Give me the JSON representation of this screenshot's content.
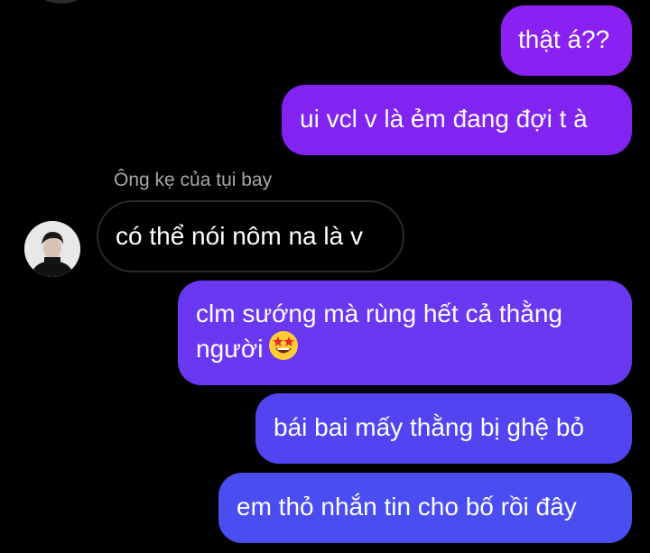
{
  "conversation": {
    "messages": [
      {
        "direction": "outgoing",
        "text": "thật á??"
      },
      {
        "direction": "outgoing",
        "text": "ui vcl v là ẻm đang đợi t à"
      },
      {
        "direction": "incoming",
        "sender": "Ông kẹ của tụi bay",
        "text": "có thể nói nôm na là v",
        "avatar_icon": "profile-photo"
      },
      {
        "direction": "outgoing",
        "text_line1": "clm sướng mà rùng hết cả thằng",
        "text_line2": "người",
        "emoji_icon": "star-struck-emoji"
      },
      {
        "direction": "outgoing",
        "text": "bái bai mấy thằng bị ghệ bỏ"
      },
      {
        "direction": "outgoing",
        "text": "em thỏ nhắn tin cho bố rồi đây"
      }
    ]
  },
  "colors": {
    "background": "#000000",
    "outgoing_gradient_top": "#8a20f2",
    "outgoing_gradient_bottom": "#4a4df0",
    "incoming_border": "#2a2a2a",
    "sender_name": "#a7a7a7",
    "text": "#ffffff"
  }
}
